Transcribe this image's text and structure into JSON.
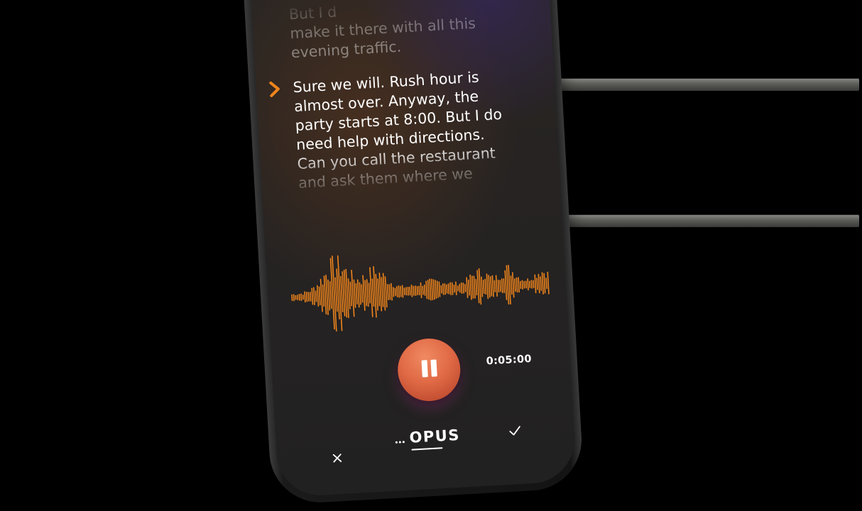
{
  "transcript": {
    "previous_lines": [
      "But I d",
      "make it there with all this",
      "evening traffic."
    ],
    "current_lines": [
      "Sure we will. Rush hour is",
      "almost over. Anyway, the",
      "party starts at 8:00. But I do",
      "need help with directions.",
      "Can you call the restaurant",
      "and ask them where we"
    ]
  },
  "player": {
    "timer": "0:05:00",
    "record_state": "paused"
  },
  "footer": {
    "logo_text": "OPUS"
  },
  "icons": {
    "current_speaker": "chevron-right-icon",
    "record": "pause-icon",
    "close": "close-icon",
    "confirm": "check-icon"
  },
  "colors": {
    "accent": "#f0851c",
    "record_button": "#e06a45",
    "background": "#000000",
    "screen": "#252322"
  }
}
